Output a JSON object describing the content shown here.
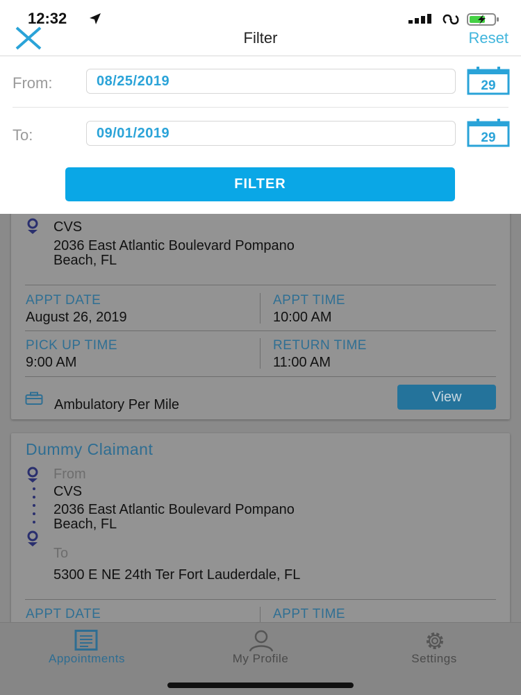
{
  "status_bar": {
    "time": "12:32"
  },
  "header": {
    "title": "Filter",
    "reset_label": "Reset"
  },
  "filter": {
    "from_label": "From:",
    "from_value": "08/25/2019",
    "to_label": "To:",
    "to_value": "09/01/2019",
    "calendar_day": "29",
    "button_label": "FILTER"
  },
  "cards": [
    {
      "location_name": "CVS",
      "address_line1": "2036 East Atlantic Boulevard Pompano",
      "address_line2": "Beach, FL",
      "appt_date_label": "APPT DATE",
      "appt_date": "August 26, 2019",
      "appt_time_label": "APPT TIME",
      "appt_time": "10:00 AM",
      "pickup_label": "PICK UP TIME",
      "pickup_time": "9:00 AM",
      "return_label": "RETURN TIME",
      "return_time": "11:00 AM",
      "service": "Ambulatory Per Mile",
      "view_label": "View"
    },
    {
      "claimant": "Dummy Claimant",
      "from_label": "From",
      "from_name": "CVS",
      "from_line1": "2036 East Atlantic Boulevard Pompano",
      "from_line2": "Beach, FL",
      "to_label": "To",
      "to_address": "5300 E NE 24th Ter Fort Lauderdale, FL",
      "appt_date_label": "APPT DATE",
      "appt_time_label": "APPT TIME"
    }
  ],
  "tabs": [
    {
      "label": "Appointments",
      "icon": "document-icon",
      "active": true
    },
    {
      "label": "My Profile",
      "icon": "person-icon",
      "active": false
    },
    {
      "label": "Settings",
      "icon": "gear-icon",
      "active": false
    }
  ],
  "colors": {
    "accent": "#0aa7e6",
    "link": "#40b5dc",
    "date_text": "#2aa3d8",
    "active_tab": "#2e6d92"
  }
}
